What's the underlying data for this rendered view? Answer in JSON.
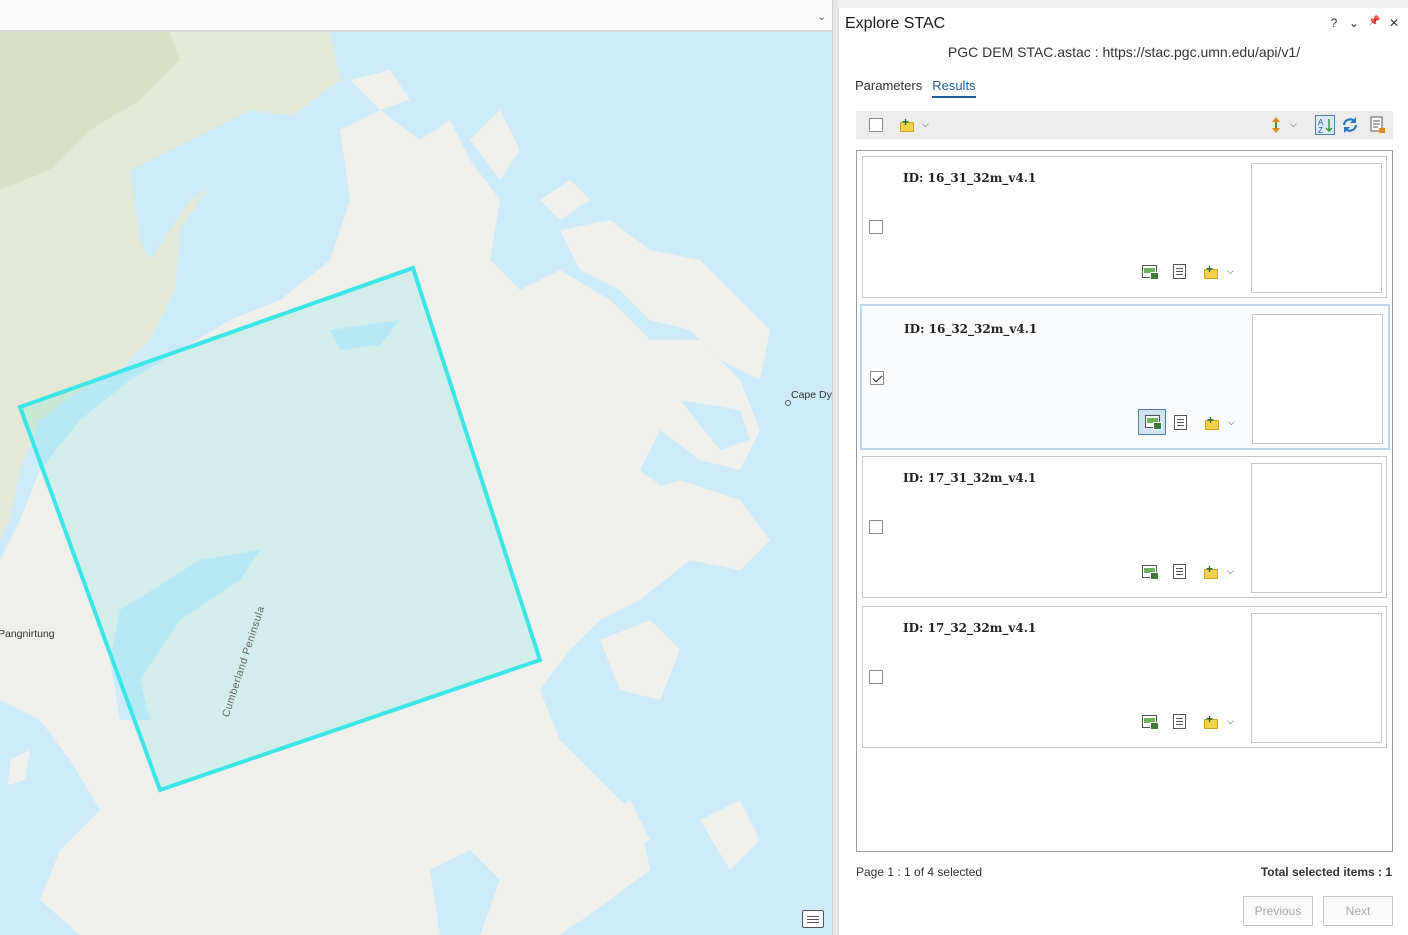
{
  "map": {
    "labels": {
      "cape": "Cape Dy",
      "town": "Pangnirtung",
      "peninsula": "Cumberland Peninsula"
    },
    "colors": {
      "water": "#cdeaf8",
      "land": "#efefeb",
      "footprint": "#3de6e6"
    }
  },
  "pane": {
    "title": "Explore STAC",
    "controls": [
      "?",
      "⌄",
      "📌",
      "✕"
    ],
    "source": "PGC DEM STAC.astac : https://stac.pgc.umn.edu/api/v1/",
    "tabs": [
      "Parameters",
      "Results"
    ],
    "active_tab": "Results"
  },
  "results": {
    "items": [
      {
        "id_label": "ID: 16_31_32m_v4.1",
        "checked": false
      },
      {
        "id_label": "ID: 16_32_32m_v4.1",
        "checked": true
      },
      {
        "id_label": "ID: 17_31_32m_v4.1",
        "checked": false
      },
      {
        "id_label": "ID: 17_32_32m_v4.1",
        "checked": false
      }
    ],
    "status": "Page 1 : 1 of 4 selected",
    "total": "Total selected items : 1",
    "prev_label": "Previous",
    "next_label": "Next"
  }
}
